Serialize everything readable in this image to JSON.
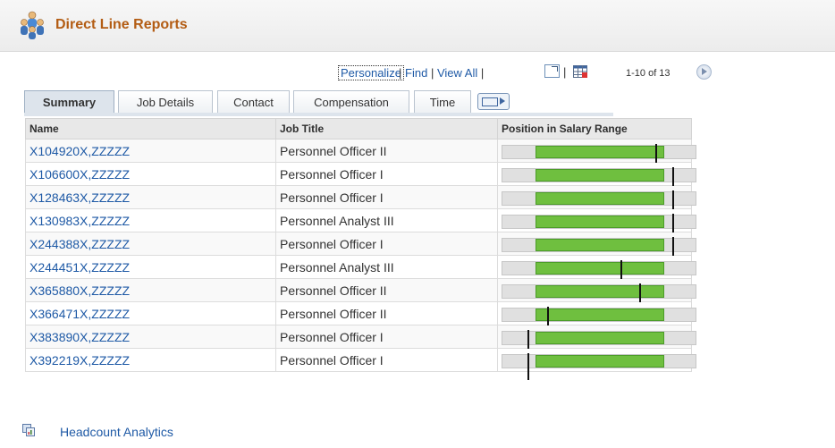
{
  "header": {
    "title": "Direct Line Reports",
    "icon": "people-group-icon"
  },
  "toolbar": {
    "personalize": "Personalize",
    "find": "Find",
    "view_all": "View All",
    "separator": "|",
    "range": "1-10 of 13"
  },
  "tabs": [
    "Summary",
    "Job Details",
    "Contact",
    "Compensation",
    "Time"
  ],
  "table": {
    "headers": {
      "name": "Name",
      "job": "Job Title",
      "salary": "Position in Salary Range"
    },
    "rows": [
      {
        "name": "X104920X,ZZZZZ",
        "job": "Personnel Officer II",
        "position": 0.79
      },
      {
        "name": "X106600X,ZZZZZ",
        "job": "Personnel Officer I",
        "position": 0.88
      },
      {
        "name": "X128463X,ZZZZZ",
        "job": "Personnel Officer I",
        "position": 0.88
      },
      {
        "name": "X130983X,ZZZZZ",
        "job": "Personnel Analyst III",
        "position": 0.88
      },
      {
        "name": "X244388X,ZZZZZ",
        "job": "Personnel Officer I",
        "position": 0.88
      },
      {
        "name": "X244451X,ZZZZZ",
        "job": "Personnel Analyst III",
        "position": 0.61
      },
      {
        "name": "X365880X,ZZZZZ",
        "job": "Personnel Officer II",
        "position": 0.71
      },
      {
        "name": "X366471X,ZZZZZ",
        "job": "Personnel Officer II",
        "position": 0.23
      },
      {
        "name": "X383890X,ZZZZZ",
        "job": "Personnel Officer I",
        "position": 0.13
      },
      {
        "name": "X392219X,ZZZZZ",
        "job": "Personnel Officer I",
        "position": 0.13
      }
    ]
  },
  "footer": {
    "link": "Headcount Analytics"
  },
  "colors": {
    "title": "#b35c13",
    "link": "#1f5aa6",
    "bar_fill": "#6fbf3f",
    "bar_bg": "#e0e0e0"
  }
}
